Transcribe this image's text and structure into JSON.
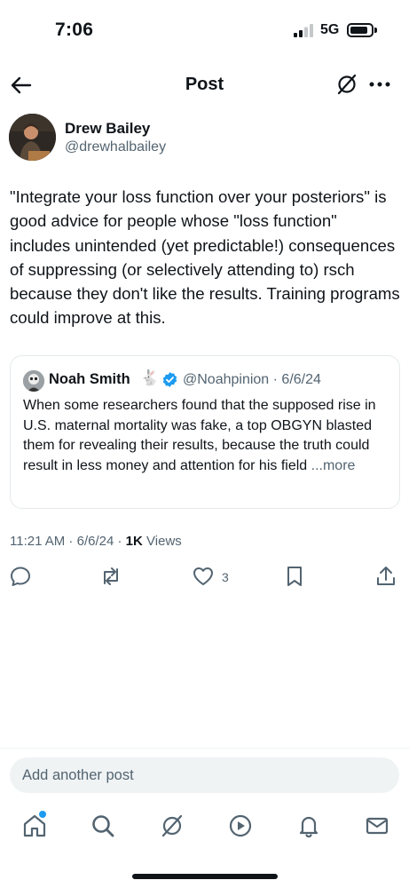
{
  "status_bar": {
    "time": "7:06",
    "network": "5G"
  },
  "header": {
    "title": "Post"
  },
  "post": {
    "author_name": "Drew Bailey",
    "author_handle": "@drewhalbailey",
    "text": "\"Integrate your loss function over your posteriors\" is good advice for people whose \"loss function\" includes unintended (yet predictable!) consequences of suppressing (or selectively attending to) rsch because they don't like the results. Training programs could improve at this.",
    "time": "11:21 AM",
    "date": "6/6/24",
    "views_count": "1K",
    "views_label": "Views",
    "like_count": "3"
  },
  "quote": {
    "author_name": "Noah Smith",
    "emoji": "🐇",
    "handle_date": "@Noahpinion · 6/6/24",
    "text": "When some researchers found that the supposed rise in U.S. maternal mortality was fake, a top OBGYN blasted them for revealing their results, because the truth could result in less money and attention for his field",
    "more_label": "...more"
  },
  "compose": {
    "placeholder": "Add another post"
  },
  "icons": {
    "back": "arrow-left-icon",
    "grok": "grok-icon",
    "more": "more-horizontal-icon",
    "reply": "reply-icon",
    "repost": "repost-icon",
    "like": "heart-icon",
    "bookmark": "bookmark-icon",
    "share": "share-icon",
    "tabs": [
      "home-icon",
      "search-icon",
      "grok-icon",
      "video-icon",
      "bell-icon",
      "mail-icon"
    ]
  },
  "colors": {
    "accent": "#1d9bf0",
    "text": "#0f1419",
    "secondary": "#536471",
    "border": "#e5e9ec"
  }
}
